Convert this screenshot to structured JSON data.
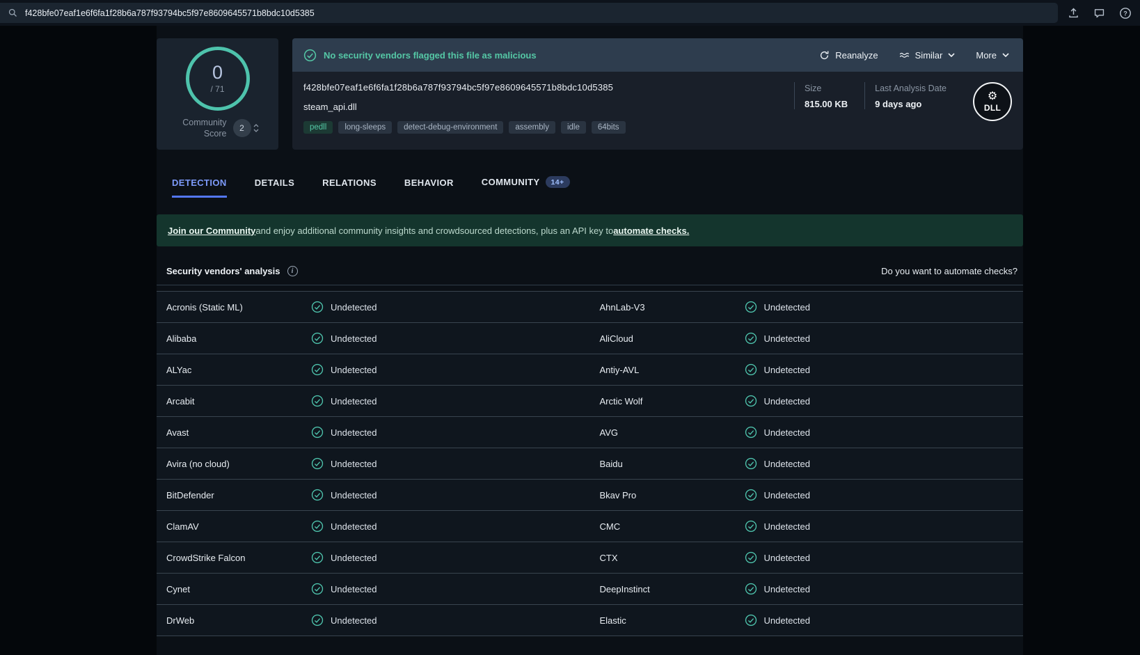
{
  "header": {
    "search_value": "f428bfe07eaf1e6f6fa1f28b6a787f93794bc5f97e8609645571b8bdc10d5385"
  },
  "score": {
    "value": "0",
    "denominator": "/ 71",
    "community_label": "Community Score",
    "community_votes": "2"
  },
  "verdict": {
    "message": "No security vendors flagged this file as malicious"
  },
  "actions": {
    "reanalyze": "Reanalyze",
    "similar": "Similar",
    "more": "More"
  },
  "file": {
    "hash": "f428bfe07eaf1e6f6fa1f28b6a787f93794bc5f97e8609645571b8bdc10d5385",
    "name": "steam_api.dll",
    "tags": [
      "pedll",
      "long-sleeps",
      "detect-debug-environment",
      "assembly",
      "idle",
      "64bits"
    ],
    "size_label": "Size",
    "size_value": "815.00 KB",
    "date_label": "Last Analysis Date",
    "date_value": "9 days ago",
    "type_badge": "DLL"
  },
  "tabs": [
    {
      "label": "DETECTION"
    },
    {
      "label": "DETAILS"
    },
    {
      "label": "RELATIONS"
    },
    {
      "label": "BEHAVIOR"
    },
    {
      "label": "COMMUNITY",
      "badge": "14+"
    }
  ],
  "banner": {
    "link1": "Join our Community",
    "text1": " and enjoy additional community insights and crowdsourced detections, plus an API key to ",
    "link2": "automate checks."
  },
  "analysis": {
    "title": "Security vendors' analysis",
    "right_text": "Do you want to automate checks?",
    "status": "Undetected",
    "rows": [
      [
        "Acronis (Static ML)",
        "AhnLab-V3"
      ],
      [
        "Alibaba",
        "AliCloud"
      ],
      [
        "ALYac",
        "Antiy-AVL"
      ],
      [
        "Arcabit",
        "Arctic Wolf"
      ],
      [
        "Avast",
        "AVG"
      ],
      [
        "Avira (no cloud)",
        "Baidu"
      ],
      [
        "BitDefender",
        "Bkav Pro"
      ],
      [
        "ClamAV",
        "CMC"
      ],
      [
        "CrowdStrike Falcon",
        "CTX"
      ],
      [
        "Cynet",
        "DeepInstinct"
      ],
      [
        "DrWeb",
        "Elastic"
      ]
    ]
  },
  "colors": {
    "accent_teal": "#4ec3ac",
    "tab_active_blue": "#7d9bfb",
    "banner_green": "#14352d"
  }
}
